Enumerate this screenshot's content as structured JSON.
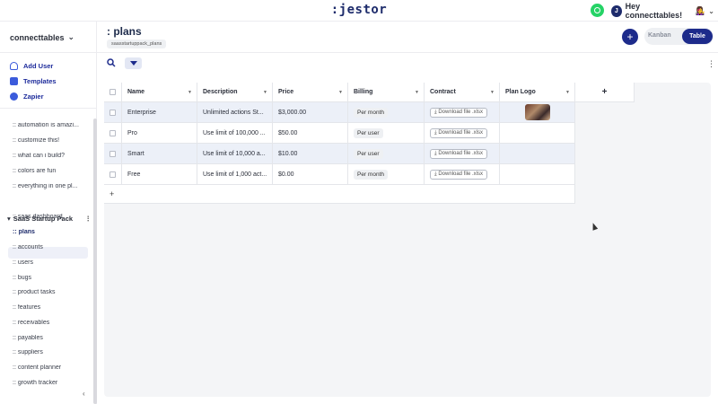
{
  "header": {
    "logo": ":jestor",
    "greeting": "Hey connecttables!",
    "avatar_initial": "J",
    "emoji": "👩‍🎤"
  },
  "sidebar": {
    "workspace": "connecttables",
    "links": [
      {
        "label": "Add User",
        "icon": "add-user-icon"
      },
      {
        "label": "Templates",
        "icon": "templates-icon"
      },
      {
        "label": "Zapier",
        "icon": "zapier-icon"
      }
    ],
    "items_top": [
      ":: automation is amazi...",
      ":: customize this!",
      ":: what can i build?",
      ":: colors are fun",
      ":: everything in one pl..."
    ],
    "group": "SaaS Startup Pack",
    "group_items": [
      ":: saas dashboard",
      ":: plans",
      ":: accounts",
      ":: users",
      ":: bugs",
      ":: product tasks",
      ":: features",
      ":: receivables",
      ":: payables",
      ":: suppliers",
      ":: content planner",
      ":: growth tracker"
    ],
    "active_item": ":: plans"
  },
  "main": {
    "title": ": plans",
    "slug": "saasstartuppack_plans",
    "views": {
      "kanban": "Kanban",
      "table": "Table",
      "selected": "Table"
    }
  },
  "table": {
    "columns": [
      "Name",
      "Description",
      "Price",
      "Billing",
      "Contract",
      "Plan Logo"
    ],
    "rows": [
      {
        "name": "Enterprise",
        "description": "Unlimited actions St...",
        "price": "$3,000.00",
        "billing": "Per month",
        "contract": "Download file .xlsx",
        "has_logo": true
      },
      {
        "name": "Pro",
        "description": "Use limit of 100,000 ...",
        "price": "$50.00",
        "billing": "Per user",
        "contract": "Download file .xlsx",
        "has_logo": false
      },
      {
        "name": "Smart",
        "description": "Use limit of 10,000 a...",
        "price": "$10.00",
        "billing": "Per user",
        "contract": "Download file .xlsx",
        "has_logo": false
      },
      {
        "name": "Free",
        "description": "Use limit of 1,000 act...",
        "price": "$0.00",
        "billing": "Per month",
        "contract": "Download file .xlsx",
        "has_logo": false
      }
    ]
  }
}
